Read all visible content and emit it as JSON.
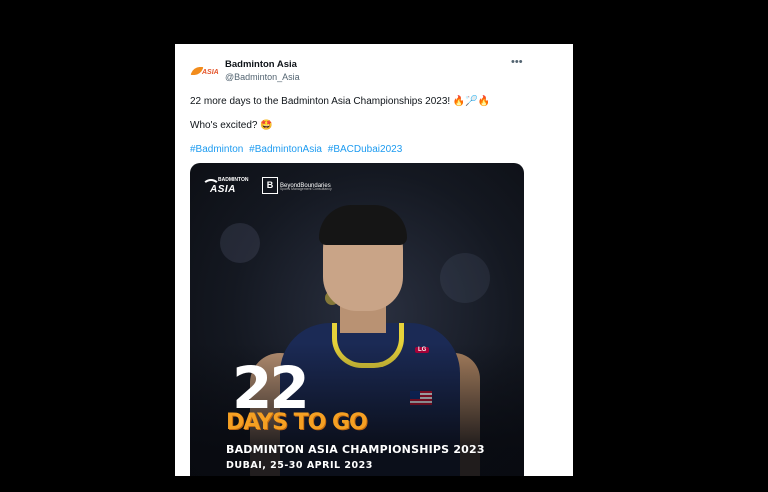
{
  "tweet": {
    "account_name": "Badminton Asia",
    "handle": "@Badminton_Asia",
    "avatar_text": "ASIA",
    "more_icon": "more-options-icon",
    "line1": "22 more days to the Badminton Asia Championships 2023! 🔥🏸🔥",
    "line2": "Who's excited? 🤩",
    "hashtags": [
      "#Badminton",
      "#BadmintonAsia",
      "#BACDubai2023"
    ]
  },
  "media": {
    "brand_top": "BADMINTON",
    "brand_main": "ASIA",
    "partner_mark": "B",
    "partner_name": "BeyondBoundaries",
    "partner_sub": "Sports Management Consultancy",
    "sponsor": "LG",
    "count": "22",
    "days_label": "DAYS TO GO",
    "event_name": "BADMINTON ASIA CHAMPIONSHIPS 2023",
    "event_dates": "DUBAI, 25-30 APRIL 2023"
  },
  "colors": {
    "page_bg": "#000000",
    "card_bg": "#ffffff",
    "link": "#1d9bf0",
    "days_accent": "#f5a023"
  }
}
